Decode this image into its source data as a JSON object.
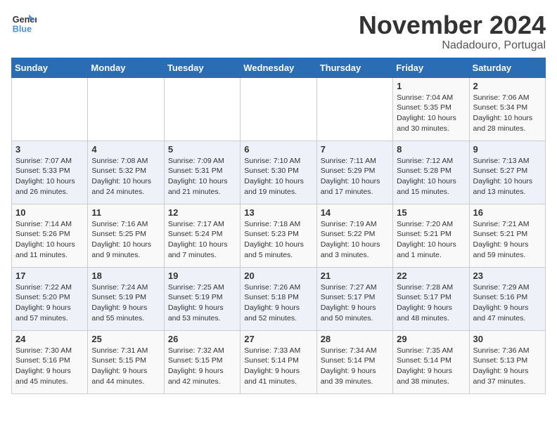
{
  "logo": {
    "line1": "General",
    "line2": "Blue"
  },
  "title": "November 2024",
  "location": "Nadadouro, Portugal",
  "days_of_week": [
    "Sunday",
    "Monday",
    "Tuesday",
    "Wednesday",
    "Thursday",
    "Friday",
    "Saturday"
  ],
  "weeks": [
    [
      {
        "day": "",
        "info": ""
      },
      {
        "day": "",
        "info": ""
      },
      {
        "day": "",
        "info": ""
      },
      {
        "day": "",
        "info": ""
      },
      {
        "day": "",
        "info": ""
      },
      {
        "day": "1",
        "info": "Sunrise: 7:04 AM\nSunset: 5:35 PM\nDaylight: 10 hours\nand 30 minutes."
      },
      {
        "day": "2",
        "info": "Sunrise: 7:06 AM\nSunset: 5:34 PM\nDaylight: 10 hours\nand 28 minutes."
      }
    ],
    [
      {
        "day": "3",
        "info": "Sunrise: 7:07 AM\nSunset: 5:33 PM\nDaylight: 10 hours\nand 26 minutes."
      },
      {
        "day": "4",
        "info": "Sunrise: 7:08 AM\nSunset: 5:32 PM\nDaylight: 10 hours\nand 24 minutes."
      },
      {
        "day": "5",
        "info": "Sunrise: 7:09 AM\nSunset: 5:31 PM\nDaylight: 10 hours\nand 21 minutes."
      },
      {
        "day": "6",
        "info": "Sunrise: 7:10 AM\nSunset: 5:30 PM\nDaylight: 10 hours\nand 19 minutes."
      },
      {
        "day": "7",
        "info": "Sunrise: 7:11 AM\nSunset: 5:29 PM\nDaylight: 10 hours\nand 17 minutes."
      },
      {
        "day": "8",
        "info": "Sunrise: 7:12 AM\nSunset: 5:28 PM\nDaylight: 10 hours\nand 15 minutes."
      },
      {
        "day": "9",
        "info": "Sunrise: 7:13 AM\nSunset: 5:27 PM\nDaylight: 10 hours\nand 13 minutes."
      }
    ],
    [
      {
        "day": "10",
        "info": "Sunrise: 7:14 AM\nSunset: 5:26 PM\nDaylight: 10 hours\nand 11 minutes."
      },
      {
        "day": "11",
        "info": "Sunrise: 7:16 AM\nSunset: 5:25 PM\nDaylight: 10 hours\nand 9 minutes."
      },
      {
        "day": "12",
        "info": "Sunrise: 7:17 AM\nSunset: 5:24 PM\nDaylight: 10 hours\nand 7 minutes."
      },
      {
        "day": "13",
        "info": "Sunrise: 7:18 AM\nSunset: 5:23 PM\nDaylight: 10 hours\nand 5 minutes."
      },
      {
        "day": "14",
        "info": "Sunrise: 7:19 AM\nSunset: 5:22 PM\nDaylight: 10 hours\nand 3 minutes."
      },
      {
        "day": "15",
        "info": "Sunrise: 7:20 AM\nSunset: 5:21 PM\nDaylight: 10 hours\nand 1 minute."
      },
      {
        "day": "16",
        "info": "Sunrise: 7:21 AM\nSunset: 5:21 PM\nDaylight: 9 hours\nand 59 minutes."
      }
    ],
    [
      {
        "day": "17",
        "info": "Sunrise: 7:22 AM\nSunset: 5:20 PM\nDaylight: 9 hours\nand 57 minutes."
      },
      {
        "day": "18",
        "info": "Sunrise: 7:24 AM\nSunset: 5:19 PM\nDaylight: 9 hours\nand 55 minutes."
      },
      {
        "day": "19",
        "info": "Sunrise: 7:25 AM\nSunset: 5:19 PM\nDaylight: 9 hours\nand 53 minutes."
      },
      {
        "day": "20",
        "info": "Sunrise: 7:26 AM\nSunset: 5:18 PM\nDaylight: 9 hours\nand 52 minutes."
      },
      {
        "day": "21",
        "info": "Sunrise: 7:27 AM\nSunset: 5:17 PM\nDaylight: 9 hours\nand 50 minutes."
      },
      {
        "day": "22",
        "info": "Sunrise: 7:28 AM\nSunset: 5:17 PM\nDaylight: 9 hours\nand 48 minutes."
      },
      {
        "day": "23",
        "info": "Sunrise: 7:29 AM\nSunset: 5:16 PM\nDaylight: 9 hours\nand 47 minutes."
      }
    ],
    [
      {
        "day": "24",
        "info": "Sunrise: 7:30 AM\nSunset: 5:16 PM\nDaylight: 9 hours\nand 45 minutes."
      },
      {
        "day": "25",
        "info": "Sunrise: 7:31 AM\nSunset: 5:15 PM\nDaylight: 9 hours\nand 44 minutes."
      },
      {
        "day": "26",
        "info": "Sunrise: 7:32 AM\nSunset: 5:15 PM\nDaylight: 9 hours\nand 42 minutes."
      },
      {
        "day": "27",
        "info": "Sunrise: 7:33 AM\nSunset: 5:14 PM\nDaylight: 9 hours\nand 41 minutes."
      },
      {
        "day": "28",
        "info": "Sunrise: 7:34 AM\nSunset: 5:14 PM\nDaylight: 9 hours\nand 39 minutes."
      },
      {
        "day": "29",
        "info": "Sunrise: 7:35 AM\nSunset: 5:14 PM\nDaylight: 9 hours\nand 38 minutes."
      },
      {
        "day": "30",
        "info": "Sunrise: 7:36 AM\nSunset: 5:13 PM\nDaylight: 9 hours\nand 37 minutes."
      }
    ]
  ]
}
